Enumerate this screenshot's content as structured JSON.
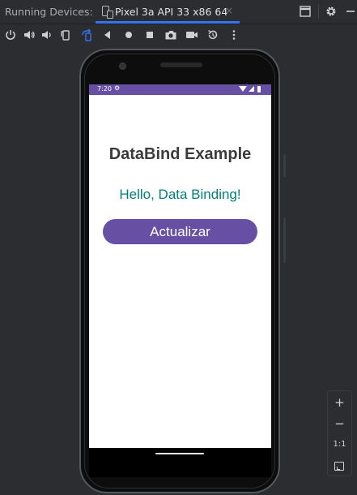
{
  "header": {
    "title": "Running Devices:",
    "tab_label": "Pixel 3a API 33 x86 64",
    "tab_close": "×"
  },
  "toolbar": {
    "icons": [
      "power-icon",
      "volume-up-icon",
      "volume-down-icon",
      "rotate-left-icon",
      "rotate-right-icon",
      "back-icon",
      "home-icon",
      "overview-icon",
      "camera-icon",
      "record-icon",
      "reset-icon",
      "more-icon"
    ]
  },
  "device": {
    "status_time": "7:20",
    "status_gear": "⚙",
    "app_title": "DataBind Example",
    "message": "Hello, Data Binding!",
    "button_label": "Actualizar"
  },
  "zoom": {
    "plus": "+",
    "minus": "−",
    "actual": "1:1"
  },
  "colors": {
    "accent": "#3574f0",
    "app_primary": "#6750a4",
    "message_text": "#00807a",
    "ide_background": "#2b2d30"
  }
}
